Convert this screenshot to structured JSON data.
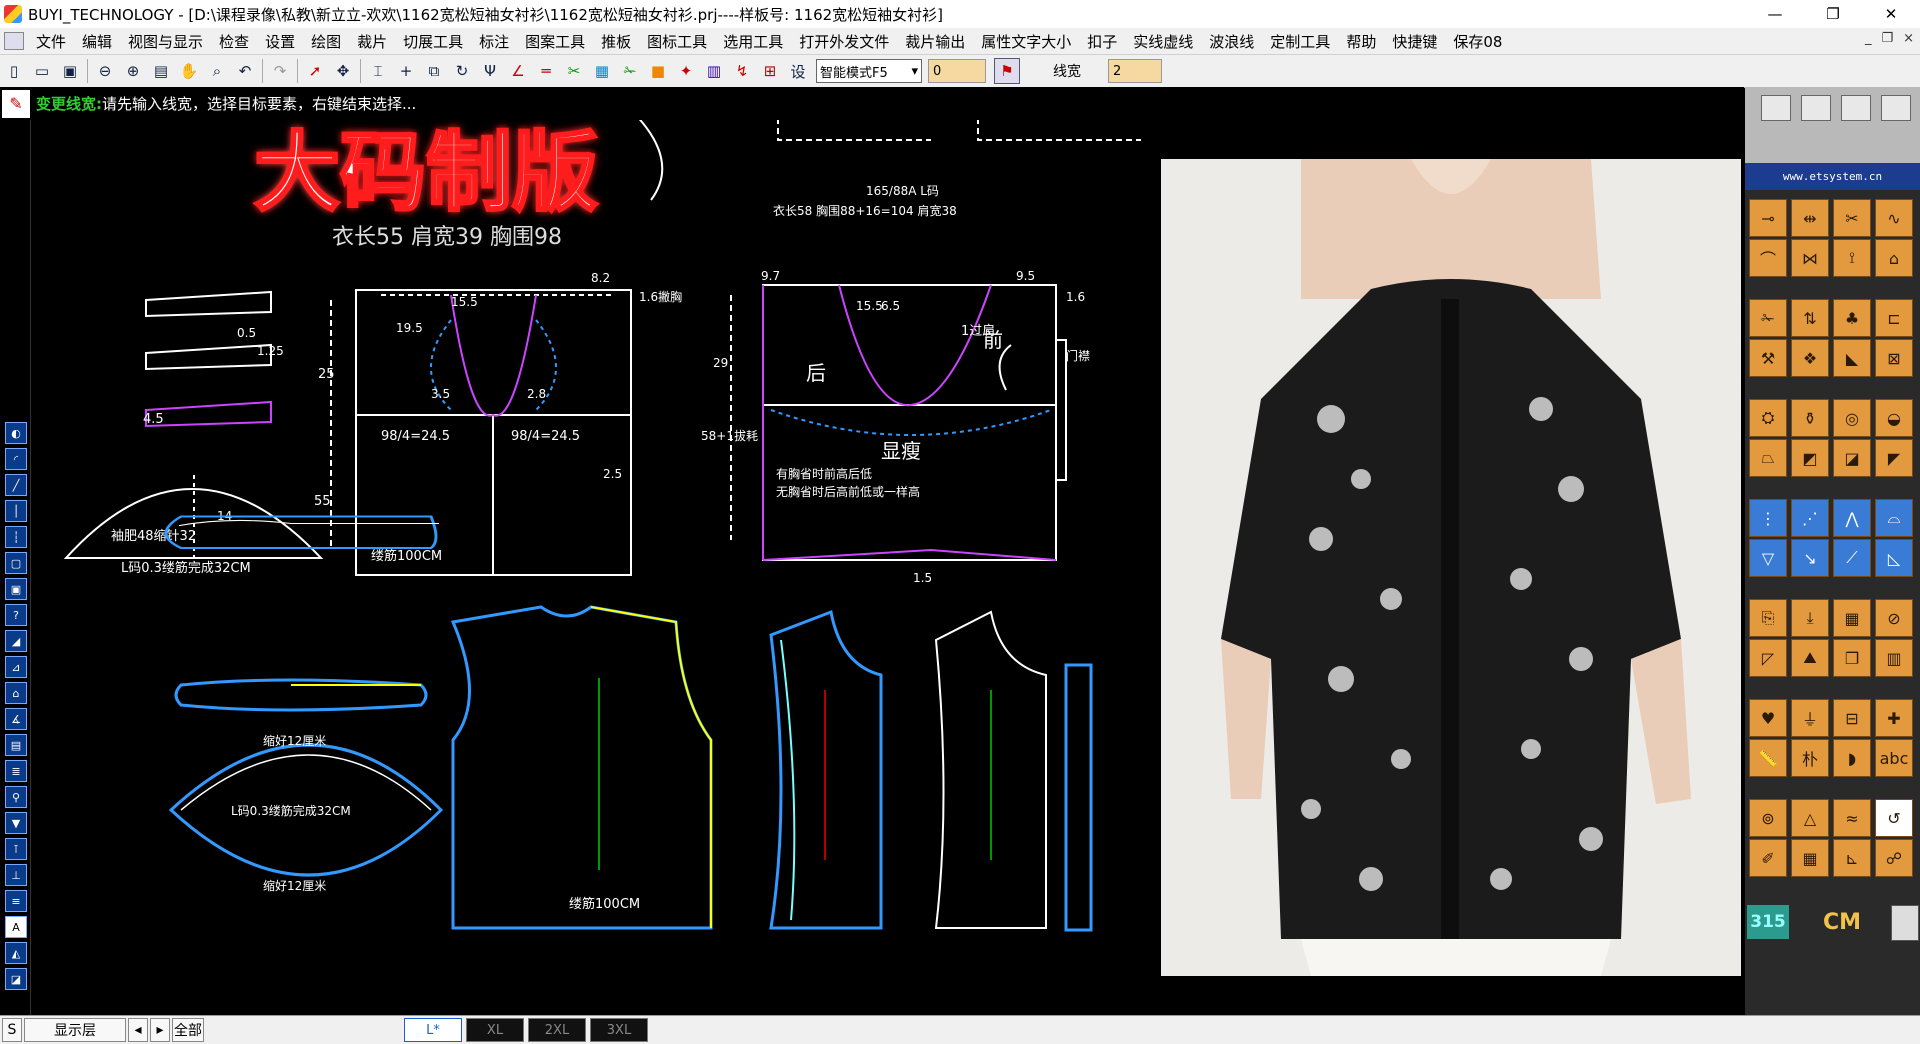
{
  "window": {
    "title": "BUYI_TECHNOLOGY - [D:\\课程录像\\私教\\新立立-欢欢\\1162宽松短袖女衬衫\\1162宽松短袖女衬衫.prj----样板号: 1162宽松短袖女衬衫]",
    "minimize": "—",
    "maximize": "❐",
    "close": "✕"
  },
  "menu": {
    "items": [
      "文件",
      "编辑",
      "视图与显示",
      "检查",
      "设置",
      "绘图",
      "裁片",
      "切展工具",
      "标注",
      "图案工具",
      "推板",
      "图标工具",
      "选用工具",
      "打开外发文件",
      "裁片输出",
      "属性文字大小",
      "扣子",
      "实线虚线",
      "波浪线",
      "定制工具",
      "帮助",
      "快捷键",
      "保存08"
    ],
    "doc_controls": [
      "_",
      "❐",
      "×"
    ]
  },
  "toolbar": {
    "mode_select": "智能模式F5",
    "value_field": "0",
    "linewidth_label": "线宽",
    "linewidth_value": "2",
    "icons": [
      "new-icon",
      "open-icon",
      "save-icon",
      "zoom-out-icon",
      "zoom-in-icon",
      "zoom-window-icon",
      "pan-icon",
      "zoom-fit-icon",
      "undo-icon",
      "redo-icon",
      "select-icon",
      "move-icon",
      "align-icon",
      "cross-icon",
      "transform-icon",
      "rotate-icon",
      "dart-icon",
      "line-icon",
      "parallel-icon",
      "knife-icon",
      "grid-icon",
      "cut-icon",
      "color-icon",
      "point-icon",
      "print-icon",
      "layer-icon",
      "measure-icon",
      "settings-icon"
    ],
    "settings_glyph": "设"
  },
  "hint": {
    "command": "变更线宽:",
    "message": "请先输入线宽，选择目标要素，右键结束选择..."
  },
  "canvas": {
    "banner": "大码制版",
    "top_header": "衣长55   肩宽39   胸围98",
    "front_spec": "165/88A  L码",
    "front_spec2": "衣长58   胸围88+16=104   肩宽38",
    "label_back": "后",
    "label_front": "前",
    "label_slim": "显瘦",
    "note1": "有胸省时前高后低",
    "note2": "无胸省时后高前低或一样高",
    "sleeve_note": "袖肥48缩针32",
    "sleeve_note2": "L码0.3缕筋完成32CM",
    "hem_note": "缕筋100CM",
    "piece_sleeve_top": "缩好12厘米",
    "piece_sleeve_bottom": "缩好12厘米",
    "piece_sleeve_mid": "L码0.3缕筋完成32CM",
    "piece_body_hem": "缕筋100CM",
    "side_note": "58+1拔耗",
    "dims": {
      "d1": "25",
      "d2": "55",
      "d3": "19.5",
      "d4": "15.5",
      "d5": "98/4=24.5",
      "d6": "98/4=24.5",
      "d7": "2.5",
      "d8": "8.2",
      "d9": "1.6撇胸",
      "d10": "9.7",
      "d11": "15.5",
      "d12": "6.5",
      "d13": "9.5",
      "d14": "29",
      "d15": "1.6",
      "d16": "2.8",
      "d17": "3.5",
      "d18": "14",
      "d19": "4.5",
      "d20": "1.5",
      "d21": "0.5",
      "d22": "1.25",
      "d23": "1过肩",
      "d24": "门襟"
    }
  },
  "side_panel": {
    "banner": "www.etsystem.cn",
    "counter": "315",
    "unit": "CM"
  },
  "status": {
    "layer_label": "S",
    "layer_display": "显示层",
    "all": "全部",
    "sizes": [
      "L*",
      "XL",
      "2XL",
      "3XL"
    ]
  }
}
